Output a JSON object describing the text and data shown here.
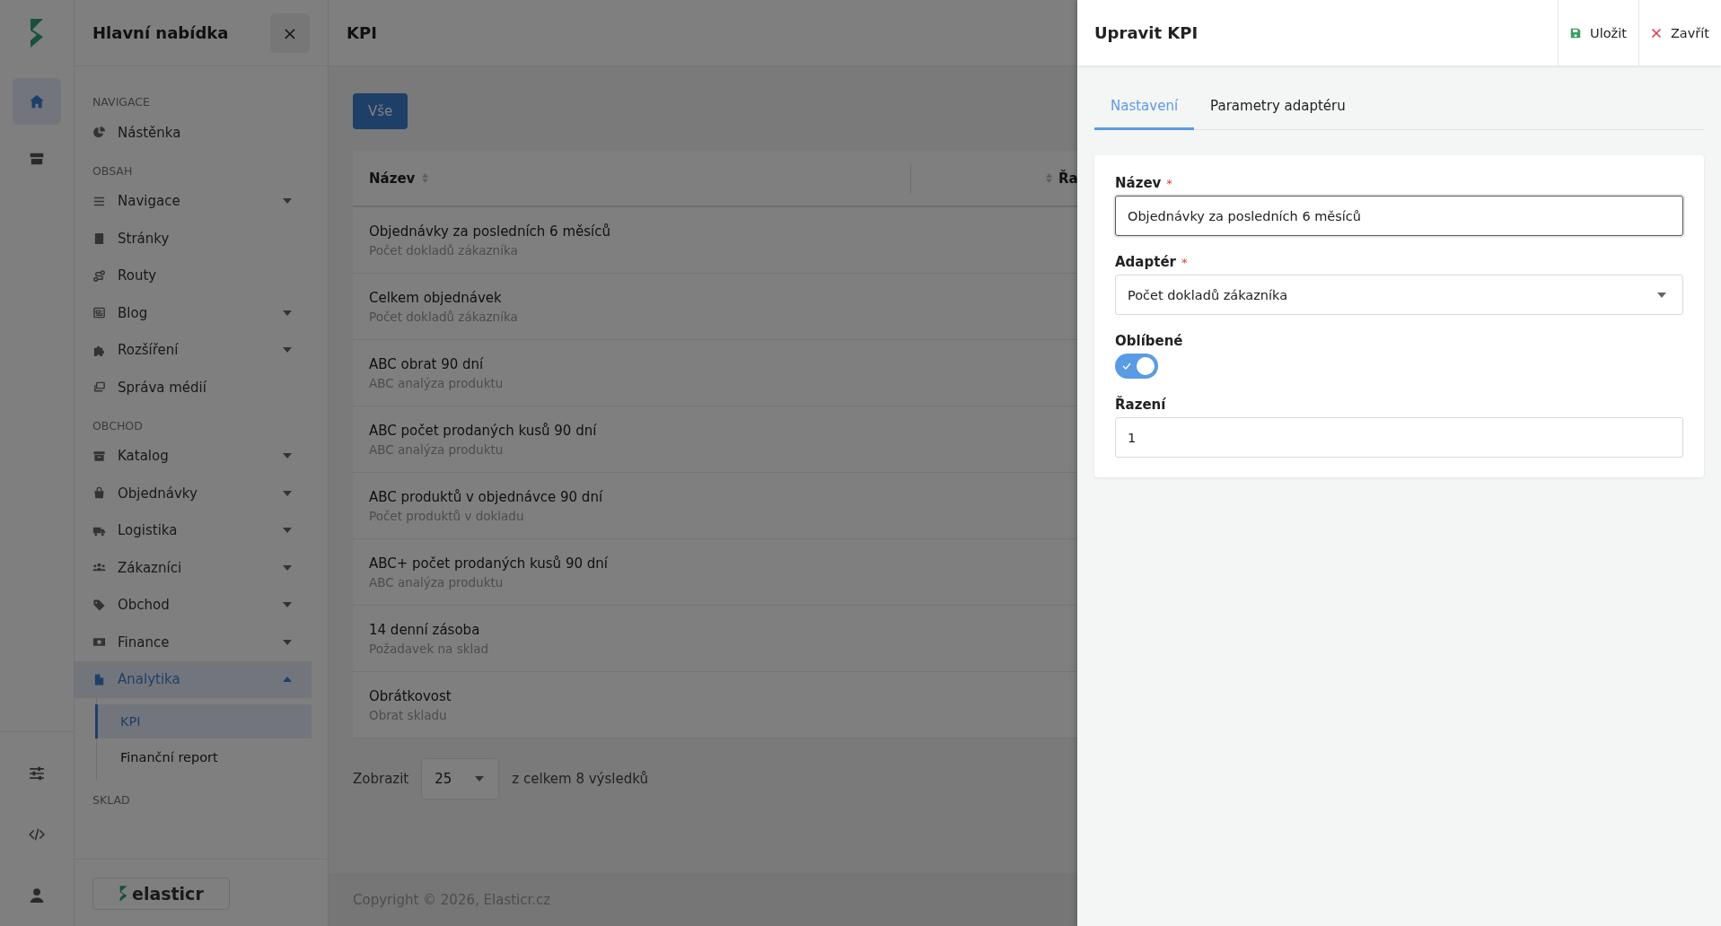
{
  "rail": {
    "top": [
      {
        "selected": true
      },
      {
        "selected": false
      }
    ]
  },
  "sidebar": {
    "title": "Hlavní nabídka",
    "close": "×",
    "sections": [
      {
        "heading": "NAVIGACE",
        "items": [
          {
            "label": "Nástěnka",
            "selected": false
          }
        ]
      },
      {
        "heading": "OBSAH",
        "items": [
          {
            "label": "Navigace",
            "selected": false,
            "expanded": false
          },
          {
            "label": "Stránky",
            "selected": false
          },
          {
            "label": "Routy",
            "selected": false
          },
          {
            "label": "Blog",
            "selected": false,
            "expanded": false
          },
          {
            "label": "Rozšíření",
            "selected": false,
            "expanded": false
          },
          {
            "label": "Správa médií",
            "selected": false
          }
        ]
      },
      {
        "heading": "OBCHOD",
        "items": [
          {
            "label": "Katalog",
            "selected": false,
            "expanded": false
          },
          {
            "label": "Objednávky",
            "selected": false,
            "expanded": false
          },
          {
            "label": "Logistika",
            "selected": false,
            "expanded": false
          },
          {
            "label": "Zákazníci",
            "selected": false,
            "expanded": false
          },
          {
            "label": "Obchod",
            "selected": false,
            "expanded": false
          },
          {
            "label": "Finance",
            "selected": false,
            "expanded": false
          },
          {
            "label": "Analytika",
            "selected": true,
            "expanded": true,
            "children": [
              {
                "label": "KPI",
                "selected": true
              },
              {
                "label": "Finanční report",
                "selected": false
              }
            ]
          }
        ]
      },
      {
        "heading": "SKLAD"
      }
    ],
    "logo": "elasticr"
  },
  "main": {
    "title": "KPI",
    "filters": [
      {
        "label": "Vše",
        "selected": true
      }
    ],
    "table": {
      "columns": [
        "Název",
        "Řa"
      ],
      "rows": [
        {
          "name": "Objednávky za posledních 6 měsíců",
          "adapter": "Počet dokladů zákazníka"
        },
        {
          "name": "Celkem objednávek",
          "adapter": "Počet dokladů zákazníka"
        },
        {
          "name": "ABC obrat 90 dní",
          "adapter": "ABC analýza produktu"
        },
        {
          "name": "ABC počet prodaných kusů 90 dní",
          "adapter": "ABC analýza produktu"
        },
        {
          "name": "ABC produktů v objednávce 90 dní",
          "adapter": "Počet produktů v dokladu"
        },
        {
          "name": "ABC+ počet prodaných kusů 90 dní",
          "adapter": "ABC analýza produktu"
        },
        {
          "name": "14 denní zásoba",
          "adapter": "Požadavek na sklad"
        },
        {
          "name": "Obrátkovost",
          "adapter": "Obrat skladu"
        }
      ]
    },
    "pagination": {
      "label": "Zobrazit",
      "page_size": "25",
      "summary": "z celkem 8 výsledků"
    },
    "footer": "Copyright © 2026, Elasticr.cz"
  },
  "drawer": {
    "title": "Upravit KPI",
    "actions": [
      {
        "kind": "save",
        "label": "Uložit"
      },
      {
        "kind": "close",
        "label": "Zavřít"
      }
    ],
    "tabs": [
      {
        "label": "Nastavení",
        "selected": true
      },
      {
        "label": "Parametry adaptéru",
        "selected": false
      }
    ],
    "fields": [
      {
        "kind": "text",
        "label": "Název",
        "required_mark": "*",
        "value": "Objednávky za posledních 6 měsíců",
        "focused": true
      },
      {
        "kind": "select",
        "label": "Adaptér",
        "required_mark": "*",
        "value": "Počet dokladů zákazníka"
      },
      {
        "kind": "toggle",
        "label": "Oblíbené",
        "on": true
      },
      {
        "kind": "text",
        "label": "Řazení",
        "value": "1",
        "focused": false
      }
    ]
  }
}
